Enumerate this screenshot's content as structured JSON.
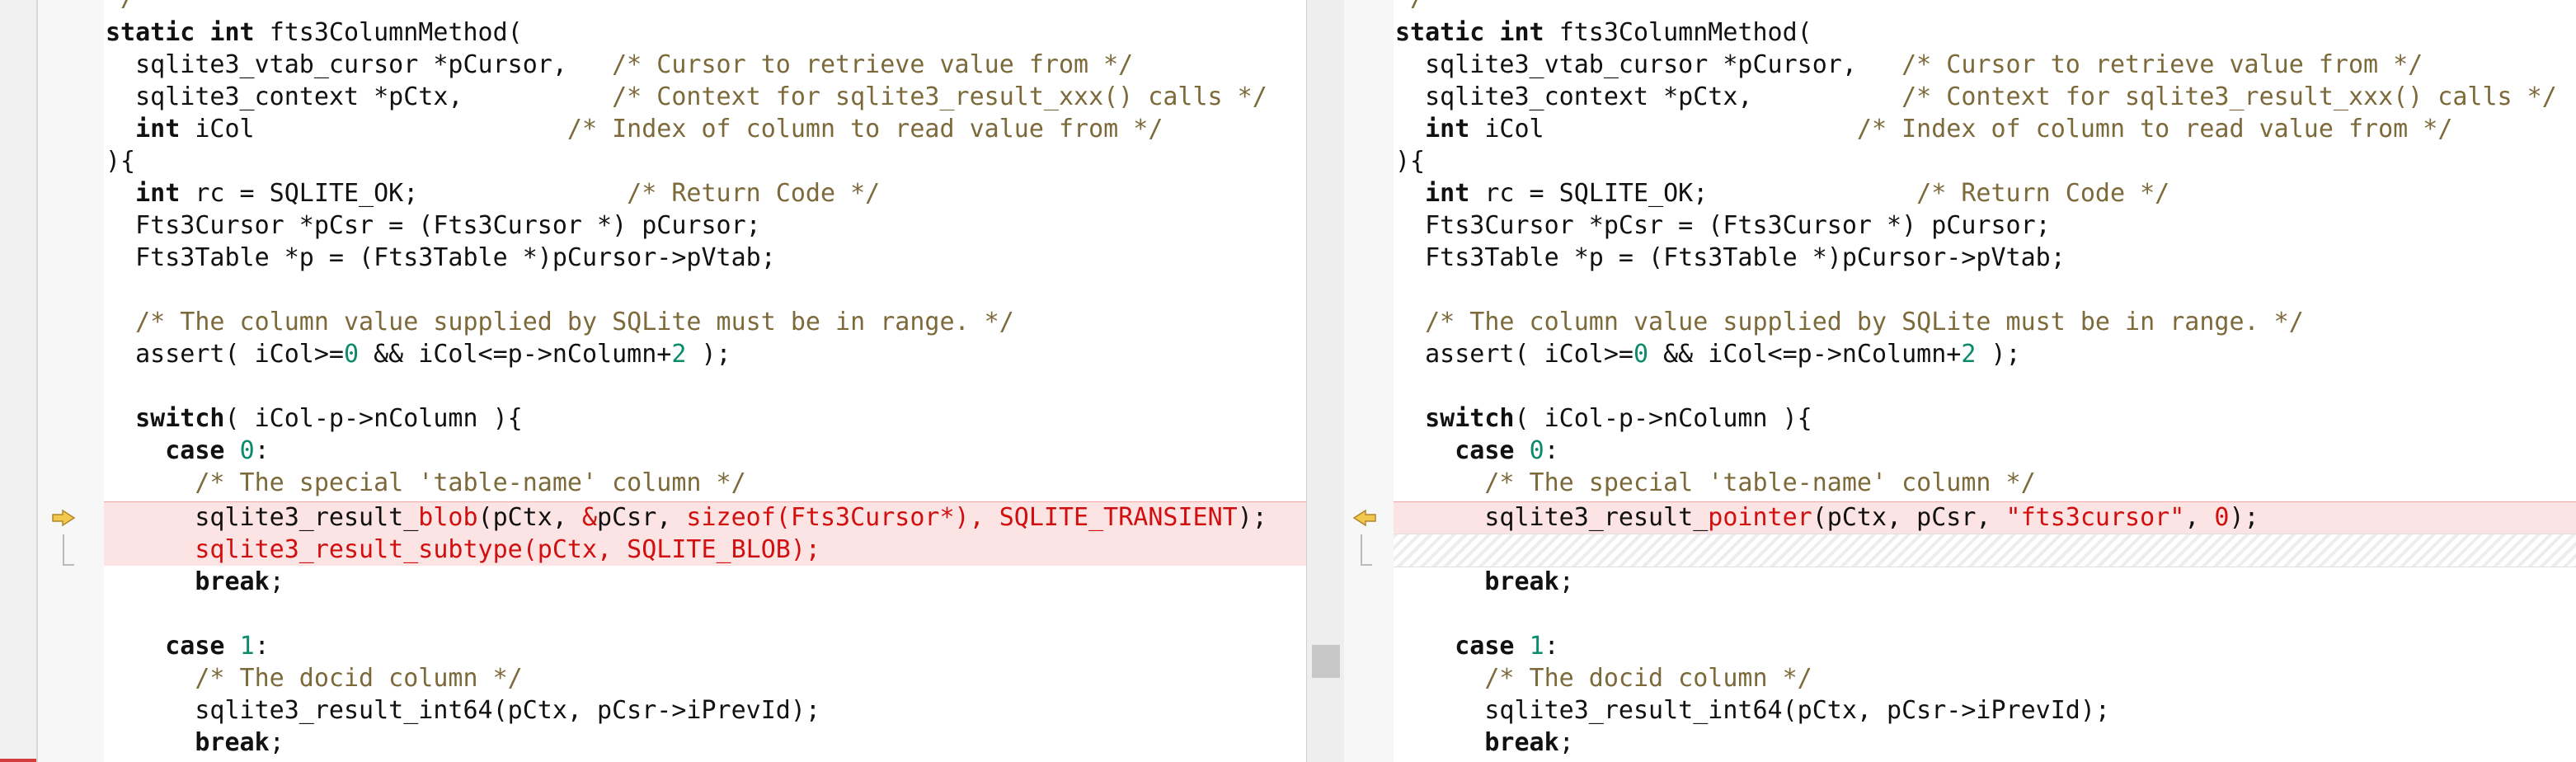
{
  "left_pane": {
    "top_fragment": "*/",
    "lines": {
      "l1_kw": "static int ",
      "l1_rest": "fts3ColumnMethod(",
      "l2_code": "  sqlite3_vtab_cursor *pCursor,   ",
      "l2_cm": "/* Cursor to retrieve value from */",
      "l3_code": "  sqlite3_context *pCtx,          ",
      "l3_cm": "/* Context for sqlite3_result_xxx() calls */",
      "l4_pre": "  ",
      "l4_kw": "int",
      "l4_code": " iCol                     ",
      "l4_cm": "/* Index of column to read value from */",
      "l5": "){",
      "l6_pre": "  ",
      "l6_kw": "int",
      "l6_code": " rc = SQLITE_OK;              ",
      "l6_cm": "/* Return Code */",
      "l7": "  Fts3Cursor *pCsr = (Fts3Cursor *) pCursor;",
      "l8": "  Fts3Table *p = (Fts3Table *)pCursor->pVtab;",
      "l10_cm": "  /* The column value supplied by SQLite must be in range. */",
      "l11_a": "  assert( iCol>=",
      "l11_n1": "0",
      "l11_b": " && iCol<=p->nColumn+",
      "l11_n2": "2",
      "l11_c": " );",
      "l13_pre": "  ",
      "l13_kw": "switch",
      "l13_rest": "( iCol-p->nColumn ){",
      "l14_pre": "    ",
      "l14_kw": "case",
      "l14_sp": " ",
      "l14_num": "0",
      "l14_c": ":",
      "l15_cm": "      /* The special 'table-name' column */",
      "l16_a": "      sqlite3_result_",
      "l16_b": "blob",
      "l16_c": "(pCtx, ",
      "l16_d": "&",
      "l16_e": "pCsr, ",
      "l16_f": "sizeof(Fts3Cursor*), SQLITE_TRANSIENT",
      "l16_g": ");",
      "l17_del": "      sqlite3_result_subtype(pCtx, SQLITE_BLOB);",
      "l18_pre": "      ",
      "l18_kw": "break",
      "l18_c": ";",
      "l20_pre": "    ",
      "l20_kw": "case",
      "l20_sp": " ",
      "l20_num": "1",
      "l20_c": ":",
      "l21_cm": "      /* The docid column */",
      "l22": "      sqlite3_result_int64(pCtx, pCsr->iPrevId);",
      "l23_pre": "      ",
      "l23_kw": "break",
      "l23_c": ";"
    }
  },
  "right_pane": {
    "top_fragment": "*/",
    "lines": {
      "l16_a": "      sqlite3_result_",
      "l16_b": "pointer",
      "l16_c": "(pCtx, pCsr, ",
      "l16_str": "\"fts3cursor\"",
      "l16_d": ", ",
      "l16_num": "0",
      "l16_e": ");"
    }
  },
  "colors": {
    "deleted_bg": "#fde4e4",
    "deleted_text": "#d10f0f",
    "comment": "#7d6a3b",
    "number": "#0c8a6c",
    "arrow": "#e3b23c"
  },
  "icons": {
    "left_change_marker": "arrow-right-icon",
    "right_change_marker": "arrow-left-icon"
  }
}
